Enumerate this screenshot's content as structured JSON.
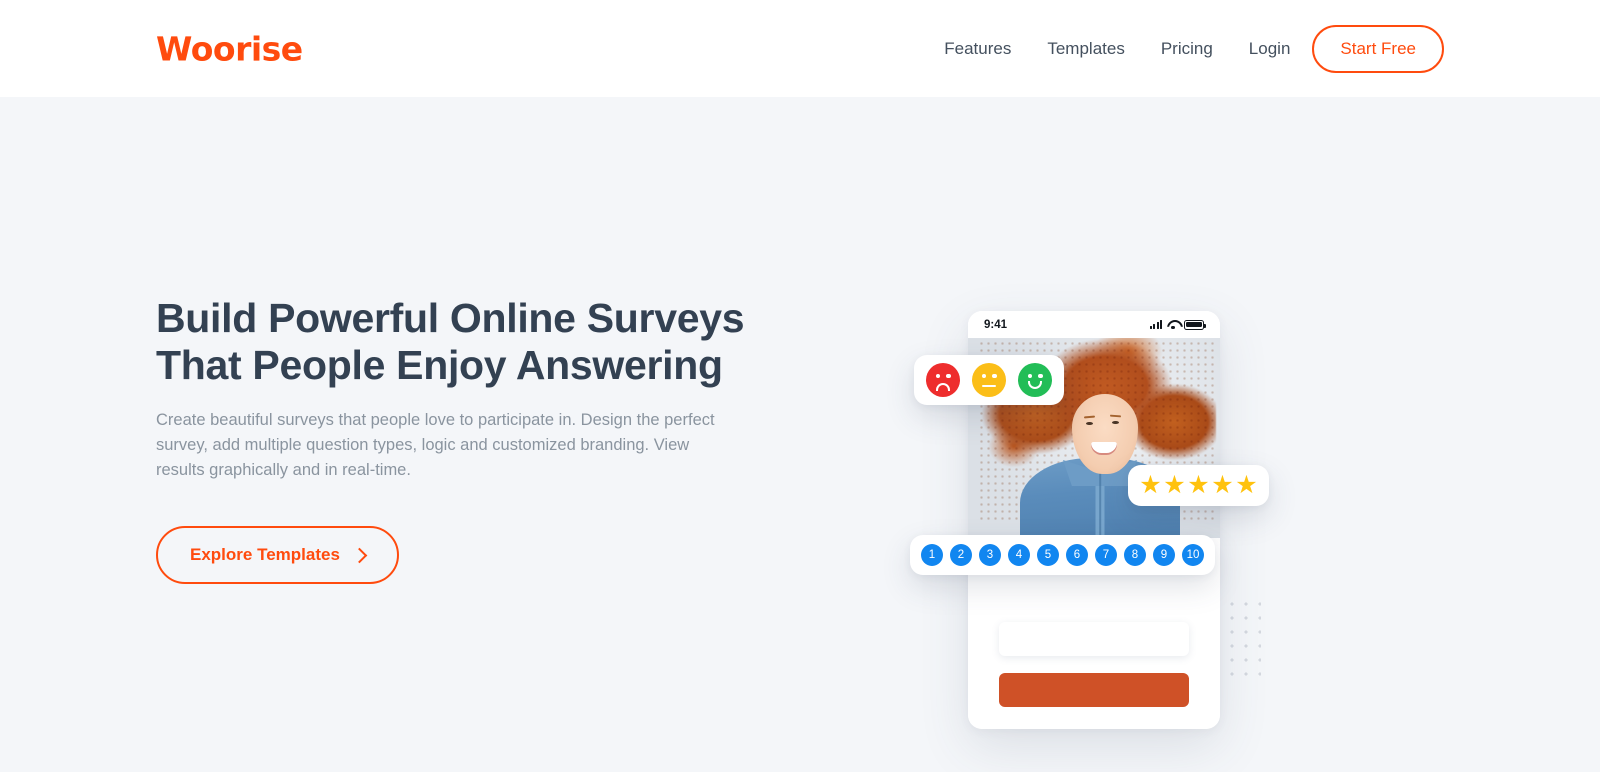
{
  "header": {
    "logo_text": "Woorise",
    "nav_links": [
      {
        "label": "Features"
      },
      {
        "label": "Templates"
      },
      {
        "label": "Pricing"
      },
      {
        "label": "Login"
      }
    ],
    "cta_label": "Start Free"
  },
  "hero": {
    "title_line1": "Build Powerful Online Surveys",
    "title_line2": "That People Enjoy Answering",
    "subtitle": "Create beautiful surveys that people love to participate in. Design the perfect survey, add multiple question types, logic and customized branding. View results graphically and in real-time.",
    "cta_label": "Explore Templates"
  },
  "illustration": {
    "phone": {
      "status_time": "9:41",
      "status_icons": [
        "signal-icon",
        "wifi-icon",
        "battery-icon"
      ]
    },
    "emoji_card": {
      "faces": [
        {
          "name": "sad-face",
          "color": "#EE2D2D"
        },
        {
          "name": "neutral-face",
          "color": "#FBBE18"
        },
        {
          "name": "happy-face",
          "color": "#22BD57"
        }
      ]
    },
    "star_card": {
      "glyph": "★",
      "count": 5,
      "color": "#FFC20E",
      "stars": [
        "★",
        "★",
        "★",
        "★",
        "★"
      ]
    },
    "rating_scale": {
      "values": [
        "1",
        "2",
        "3",
        "4",
        "5",
        "6",
        "7",
        "8",
        "9",
        "10"
      ],
      "color": "#1186F0"
    },
    "form": {
      "input_placeholder": "",
      "submit_label": "",
      "submit_color": "#CF5127"
    }
  },
  "colors": {
    "brand_orange": "#FF4B0E",
    "heading": "#334152",
    "body_text": "#8A949F",
    "page_bg": "#F4F6F9"
  }
}
